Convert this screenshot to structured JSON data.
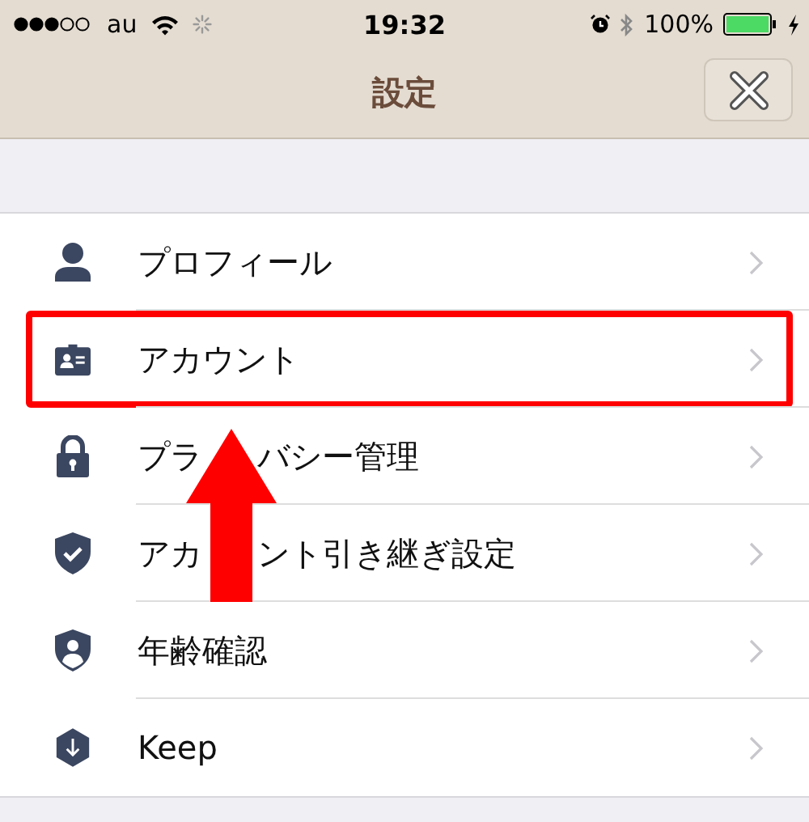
{
  "status_bar": {
    "carrier": "au",
    "time": "19:32",
    "battery": "100%"
  },
  "nav": {
    "title": "設定"
  },
  "rows": [
    {
      "label_parts": [
        "プロフィール"
      ],
      "highlighted": false
    },
    {
      "label_parts": [
        "アカウント"
      ],
      "highlighted": true
    },
    {
      "label_parts": [
        "プラ",
        "バシー管理"
      ],
      "highlighted": false
    },
    {
      "label_parts": [
        "アカ",
        "ント引き継ぎ設定"
      ],
      "highlighted": false
    },
    {
      "label_parts": [
        "年齢確認"
      ],
      "highlighted": false
    },
    {
      "label_parts": [
        "Keep"
      ],
      "highlighted": false
    }
  ]
}
